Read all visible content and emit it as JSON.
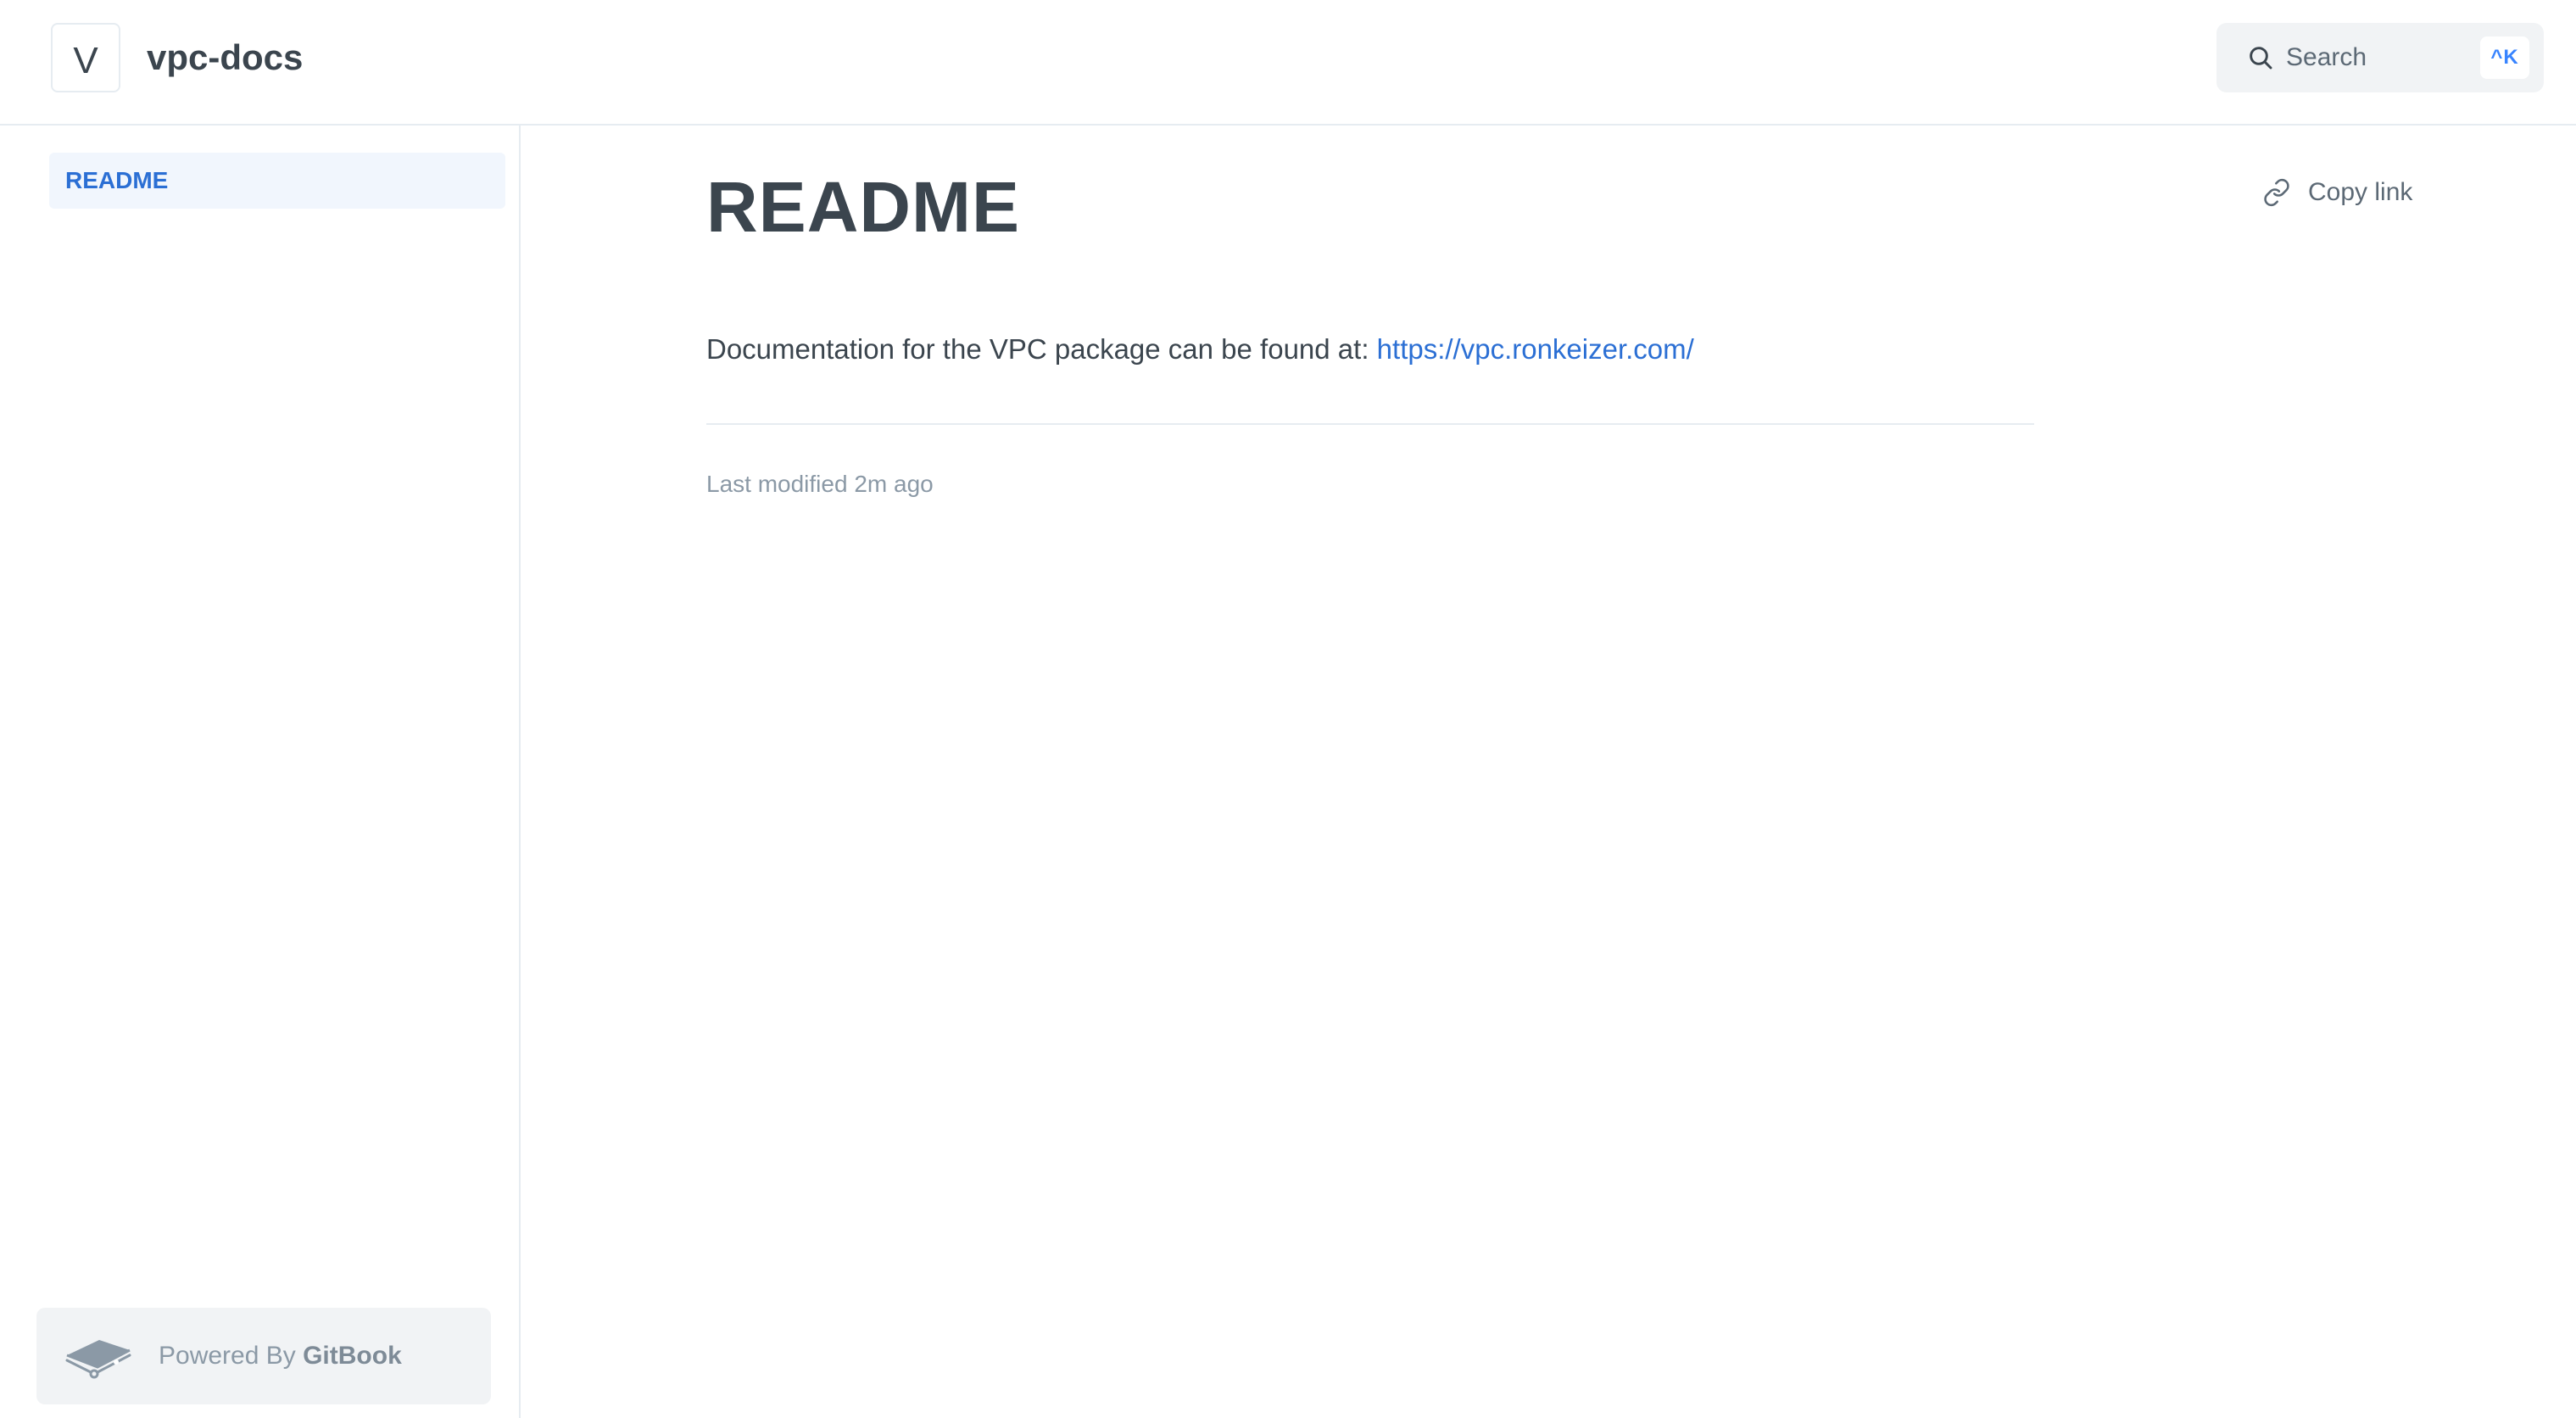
{
  "header": {
    "logo_letter": "V",
    "site_title": "vpc-docs",
    "search": {
      "placeholder": "Search",
      "shortcut": "^K"
    }
  },
  "sidebar": {
    "items": [
      {
        "label": "README",
        "active": true
      }
    ],
    "footer": {
      "prefix": "Powered By",
      "brand": "GitBook"
    }
  },
  "main": {
    "title": "README",
    "copy_link_label": "Copy link",
    "body_prefix": "Documentation for the VPC package can be found at:",
    "link_text": "https://vpc.ronkeizer.com/",
    "last_modified": "Last modified 2m ago"
  },
  "icons": {
    "search": "search-icon",
    "copy_link": "link-icon",
    "gitbook": "gitbook-logo-icon"
  },
  "colors": {
    "text": "#3b454e",
    "accent": "#2b6fd4",
    "muted": "#8b99a6",
    "border": "#e6ecf1",
    "active_bg": "#f1f6fd",
    "panel_bg": "#f1f3f5"
  }
}
